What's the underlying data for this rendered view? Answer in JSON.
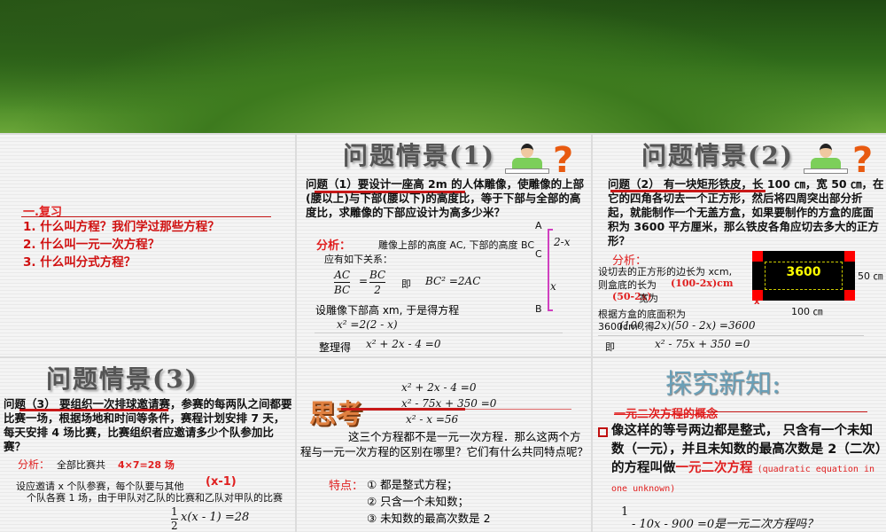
{
  "review": {
    "heading": "一.复习",
    "items": [
      "1. 什么叫方程？我们学过那些方程？",
      "2. 什么叫一元一次方程？",
      "3. 什么叫分式方程？"
    ]
  },
  "s1": {
    "title": "问题情景(1)",
    "question": "问题（1）要设计一座高 2m 的人体雕像，使雕像的上部(腰以上)与下部(腰以下)的高度比，等于下部与全部的高度比，求雕像的下部应设计为高多少米？",
    "analysis_label": "分析：",
    "analysis": "雕像上部的高度 AC, 下部的高度 BC",
    "relation": "应有如下关系：",
    "frac1_num": "AC",
    "frac1_den": "BC",
    "frac2_num": "BC",
    "frac2_den": "2",
    "ji": "即",
    "eq1": "BC² =2AC",
    "set": "设雕像下部高 xm, 于是得方程",
    "eq2": "x² =2(2 - x)",
    "tidy": "整理得",
    "eq3": "x² + 2x - 4 =0",
    "diagram": {
      "A": "A",
      "C": "C",
      "B": "B",
      "top": "2-x",
      "bottom": "x"
    }
  },
  "s2": {
    "title": "问题情景(2)",
    "question": "问题（2） 有一块矩形铁皮，长 100 ㎝，宽 50 ㎝，在它的四角各切去一个正方形，然后将四周突出部分折起，就能制作一个无盖方盒，如果要制作的方盒的底面积为 3600 平方厘米，那么铁皮各角应切去多大的正方形？",
    "analysis_label": "分析：",
    "l1": "设切去的正方形的边长为 xcm,",
    "l2": "则盒底的长为",
    "len": "(100-2x)cm",
    "wid": "(50-2x)",
    "wid_label": "宽为",
    "l3": "根据方盒的底面积为",
    "l4": "3600cm²,得",
    "eq1": "(100 - 2x)(50 - 2x) =3600",
    "ji": "即",
    "eq2": "x² - 75x + 350 =0",
    "area": "3600",
    "w": "50 ㎝",
    "h": "100 ㎝",
    "x": "x"
  },
  "s3": {
    "title": "问题情景(3)",
    "question": "问题（3） 要组织一次排球邀请赛，参赛的每两队之间都要比赛一场，根据场地和时间等条件，赛程计划安排 7 天，每天安排 4 场比赛，比赛组织者应邀请多少个队参加比赛？",
    "analysis_label": "分析：",
    "analysis": "全部比赛共",
    "games": "4×7=28 场",
    "l1": "设应邀请 x 个队参赛，每个队要与其他",
    "xm1": "(x-1)",
    "l2": "个队各赛 1 场，由于甲队对乙队的比赛和乙队对甲队的比赛",
    "eq_num": "1",
    "eq_den": "2",
    "eq": "x(x - 1) =28"
  },
  "s4": {
    "logo": "思考",
    "eqs": [
      "x² + 2x - 4 =0",
      "x² - 75x + 350 =0",
      "x² - x =56"
    ],
    "text": "这三个方程都不是一元一次方程．那么这两个方程与一元一次方程的区别在哪里？它们有什么共同特点呢？",
    "feat_label": "特点：",
    "feats": [
      "① 都是整式方程；",
      "② 只含一个未知数；",
      "③ 未知数的最高次数是 2"
    ]
  },
  "s5": {
    "title": "探究新知:",
    "sub": "一元二次方程的概念",
    "def": "像这样的等号两边都是整式， 只含有一个未知数（一元），并且未知数的最高次数是 2（二次）的方程叫做",
    "term": "一元二次方程",
    "en": "(quadratic equation in one unknown)",
    "ask_num": "1",
    "ask": "- 10x - 900 =0是一元二次方程吗？"
  }
}
